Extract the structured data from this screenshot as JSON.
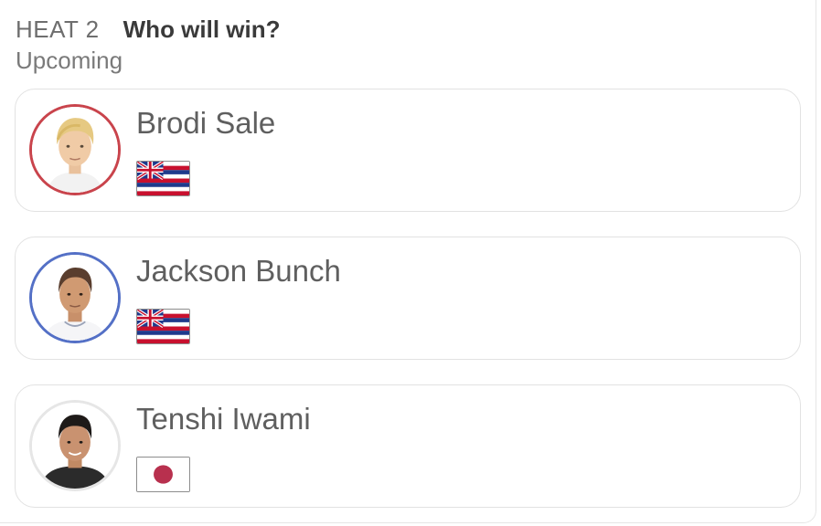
{
  "heat": {
    "label": "HEAT 2",
    "question": "Who will win?",
    "status": "Upcoming"
  },
  "surfers": [
    {
      "name": "Brodi Sale",
      "flag": "hawaii-flag",
      "ring_color": "#c9444c",
      "avatar": "surfer-photo-blond"
    },
    {
      "name": "Jackson Bunch",
      "flag": "hawaii-flag",
      "ring_color": "#5470c6",
      "avatar": "surfer-photo-dark-hair"
    },
    {
      "name": "Tenshi Iwami",
      "flag": "japan-flag",
      "ring_color": "#e6e6e6",
      "avatar": "surfer-photo-black-shirt"
    }
  ]
}
